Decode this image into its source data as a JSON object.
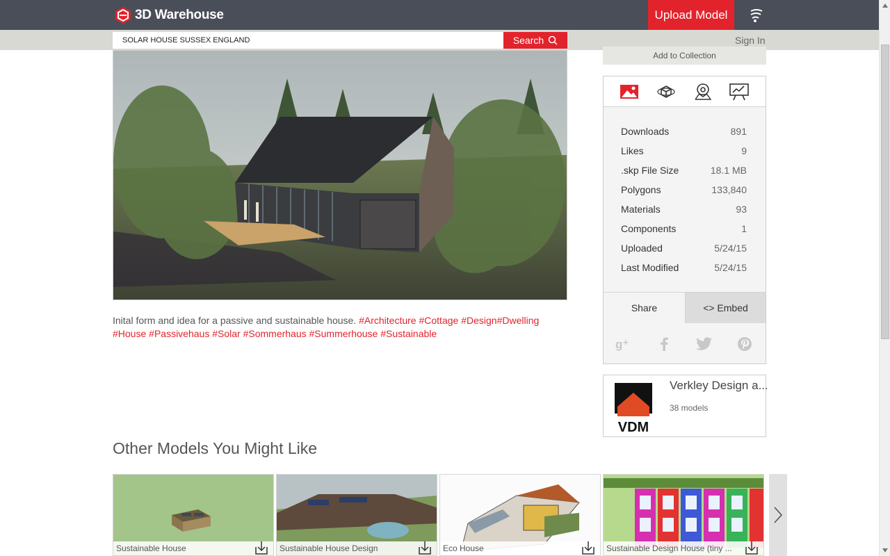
{
  "header": {
    "brand": "3D Warehouse",
    "upload_label": "Upload Model",
    "icons": {
      "logo": "warehouse-logo-icon",
      "menu": "signal-menu-icon"
    }
  },
  "search": {
    "value": "SOLAR HOUSE SUSSEX ENGLAND",
    "placeholder": "",
    "button_label": "Search"
  },
  "account": {
    "signin_label": "Sign In"
  },
  "model": {
    "add_to_collection": "Add to Collection",
    "description": "Inital form and idea for a passive and sustainable house.",
    "tags_line1": [
      "#Architecture",
      "#Cottage",
      "#Design",
      "#Dwelling"
    ],
    "tags_line2": [
      "#House",
      "#Passivehaus",
      "#Solar",
      "#Sommerhaus",
      "#Summerhouse",
      "#Sustainable"
    ]
  },
  "view_modes": [
    "image-icon",
    "3d-view-icon",
    "location-icon",
    "presentation-icon"
  ],
  "stats": [
    {
      "label": "Downloads",
      "value": "891"
    },
    {
      "label": "Likes",
      "value": "9"
    },
    {
      "label": ".skp File Size",
      "value": "18.1 MB"
    },
    {
      "label": "Polygons",
      "value": "133,840"
    },
    {
      "label": "Materials",
      "value": "93"
    },
    {
      "label": "Components",
      "value": "1"
    },
    {
      "label": "Uploaded",
      "value": "5/24/15"
    },
    {
      "label": "Last Modified",
      "value": "5/24/15"
    }
  ],
  "share": {
    "share_label": "Share",
    "embed_label": "<> Embed",
    "social": [
      "google-plus-icon",
      "facebook-icon",
      "twitter-icon",
      "pinterest-icon"
    ]
  },
  "author": {
    "name": "Verkley Design a...",
    "model_count": "38 models",
    "logo_text": "VDM"
  },
  "related": {
    "title": "Other Models You Might Like",
    "items": [
      {
        "label": "Sustainable House"
      },
      {
        "label": "Sustainable House Design"
      },
      {
        "label": "Eco House"
      },
      {
        "label": "Sustainable Design House (tiny ..."
      }
    ]
  },
  "colors": {
    "brand_red": "#e3232c",
    "topbar": "#4a4e58",
    "searchbar": "#d9d9d4"
  }
}
